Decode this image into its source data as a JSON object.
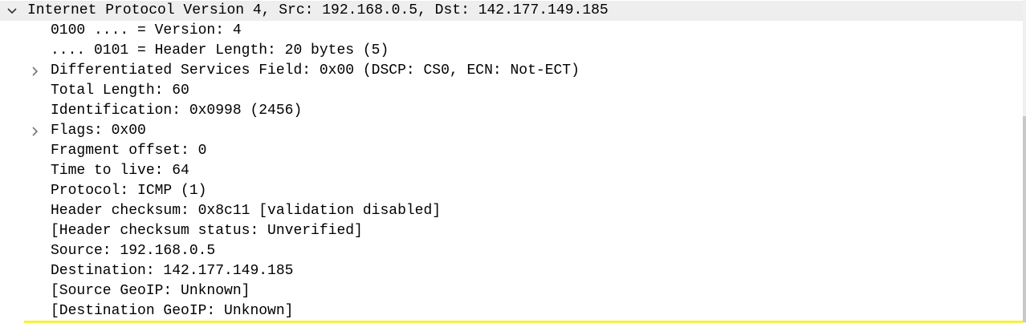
{
  "tree": {
    "root": {
      "label": "Internet Protocol Version 4, Src: 192.168.0.5, Dst: 142.177.149.185",
      "expanded": true
    },
    "children": [
      {
        "label": "0100 .... = Version: 4",
        "expandable": false
      },
      {
        "label": ".... 0101 = Header Length: 20 bytes (5)",
        "expandable": false
      },
      {
        "label": "Differentiated Services Field: 0x00 (DSCP: CS0, ECN: Not-ECT)",
        "expandable": true
      },
      {
        "label": "Total Length: 60",
        "expandable": false
      },
      {
        "label": "Identification: 0x0998 (2456)",
        "expandable": false
      },
      {
        "label": "Flags: 0x00",
        "expandable": true
      },
      {
        "label": "Fragment offset: 0",
        "expandable": false
      },
      {
        "label": "Time to live: 64",
        "expandable": false
      },
      {
        "label": "Protocol: ICMP (1)",
        "expandable": false
      },
      {
        "label": "Header checksum: 0x8c11 [validation disabled]",
        "expandable": false
      },
      {
        "label": "[Header checksum status: Unverified]",
        "expandable": false
      },
      {
        "label": "Source: 192.168.0.5",
        "expandable": false
      },
      {
        "label": "Destination: 142.177.149.185",
        "expandable": false
      },
      {
        "label": "[Source GeoIP: Unknown]",
        "expandable": false
      },
      {
        "label": "[Destination GeoIP: Unknown]",
        "expandable": false
      }
    ]
  },
  "colors": {
    "selected_row": "#eeeeee",
    "highlight": "#f5f242",
    "scrollbar_thumb": "#c8c8c8"
  }
}
